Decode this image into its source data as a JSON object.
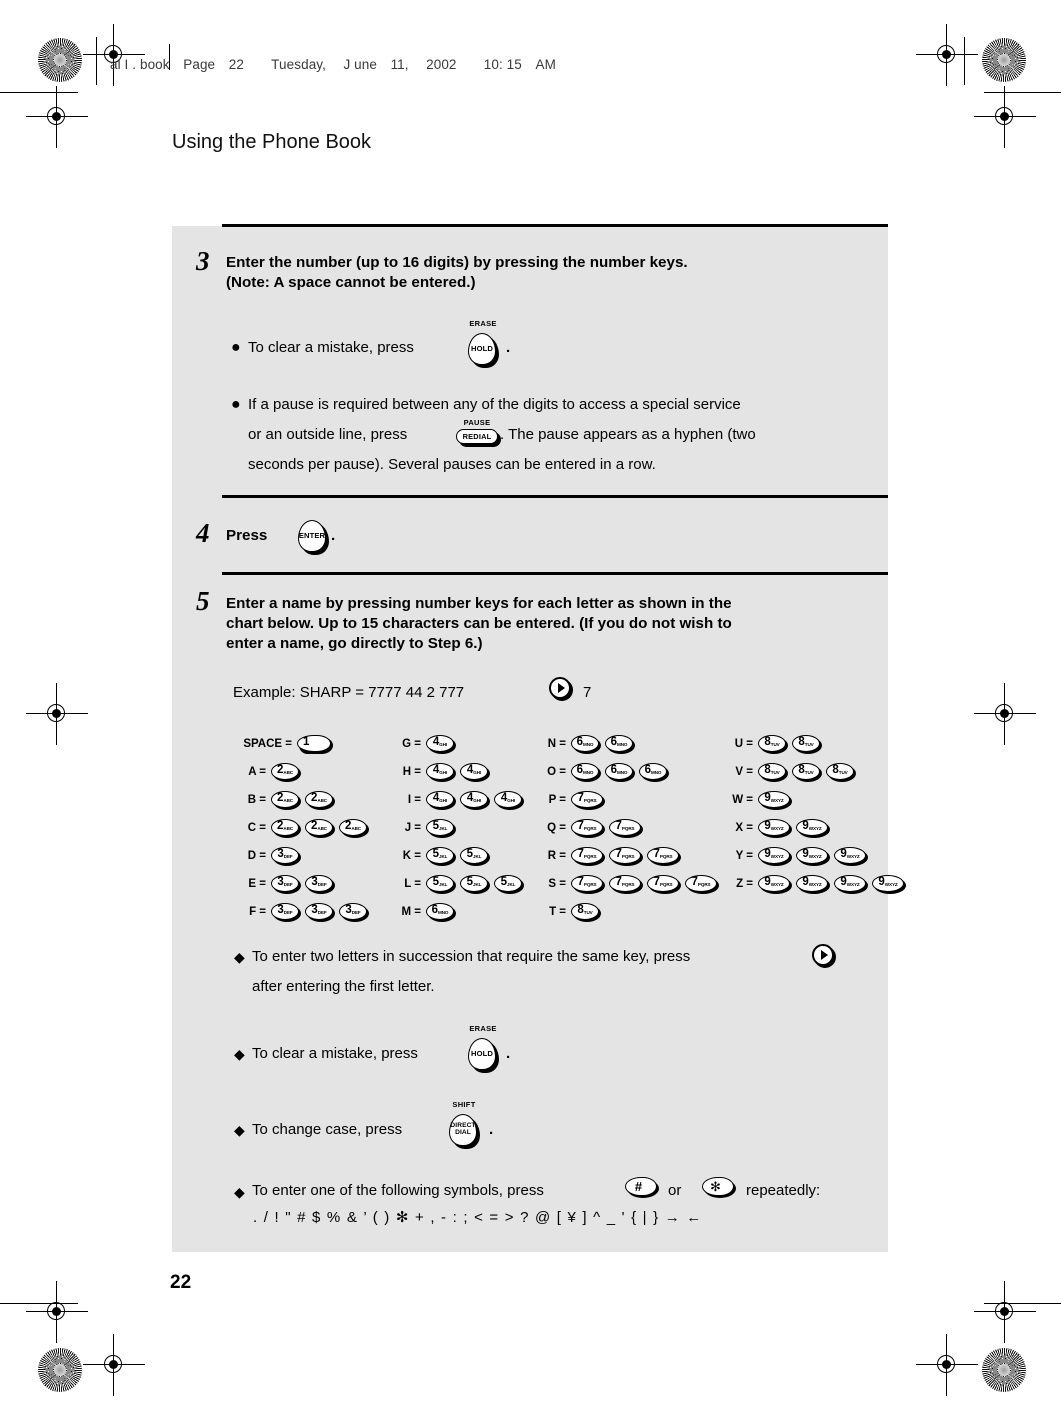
{
  "bleed_header": "al I . book　Page　22　　Tuesday, 　J une　11, 　2002　　10: 15　AM",
  "page_header": "Using the Phone Book",
  "page_number": "22",
  "steps": [
    {
      "number": "3",
      "title_line1": "Enter the number (up to 16 digits) by pressing the number keys.",
      "title_line2": "(Note: A space cannot be entered.)",
      "bullets": [
        {
          "pre": "To clear a mistake, press",
          "key": "HOLD",
          "key_top": "ERASE",
          "post": "."
        },
        {
          "line1_pre": "If a pause is required between any of the digits to access a special service",
          "line2_pre": "or an outside line, press",
          "key": "REDIAL",
          "key_top": "PAUSE",
          "line2_post": ". The pause appears as a hyphen (two",
          "line3": "seconds per pause). Several pauses can be entered in a row."
        }
      ]
    },
    {
      "number": "4",
      "title_pre": "Press",
      "key": "ENTER",
      "title_post": "."
    },
    {
      "number": "5",
      "title_line1": "Enter a name by pressing number keys for each letter as shown in the",
      "title_line2": "chart below. Up to 15 characters can be entered. (If you do not wish to",
      "title_line3": "enter a name, go directly to Step 6.)",
      "example_pre": "Example: SHARP = 7777  44  2  777",
      "example_post": "7",
      "notes": [
        {
          "line1": "To enter two letters in succession that require the same key, press",
          "line2": "after entering the first letter.",
          "icon": "right-arrow-key"
        },
        {
          "pre": "To clear a mistake, press",
          "key": "HOLD",
          "key_top": "ERASE",
          "post": "."
        },
        {
          "pre": "To change case, press",
          "key": "DIRECT DIAL",
          "key_top": "SHIFT",
          "post": "."
        },
        {
          "pre": "To enter one of the following symbols, press",
          "key1": "#",
          "mid": "or",
          "key2": "✻",
          "post": "repeatedly:",
          "symbols": ". / ! \" # $ % & ’ ( ) ✻ + , - : ; < = > ?  @  [ ¥ ] ^ _ ' { | } → ←"
        }
      ]
    }
  ],
  "letter_chart": {
    "columns": [
      {
        "rows": [
          {
            "label": "SPACE =",
            "keys": [
              {
                "digit": "1",
                "sub": "",
                "shape": "space"
              }
            ]
          },
          {
            "label": "A =",
            "keys": [
              {
                "digit": "2",
                "sub": "ABC"
              }
            ]
          },
          {
            "label": "B =",
            "keys": [
              {
                "digit": "2",
                "sub": "ABC"
              },
              {
                "digit": "2",
                "sub": "ABC"
              }
            ]
          },
          {
            "label": "C =",
            "keys": [
              {
                "digit": "2",
                "sub": "ABC"
              },
              {
                "digit": "2",
                "sub": "ABC"
              },
              {
                "digit": "2",
                "sub": "ABC"
              }
            ]
          },
          {
            "label": "D =",
            "keys": [
              {
                "digit": "3",
                "sub": "DEF"
              }
            ]
          },
          {
            "label": "E =",
            "keys": [
              {
                "digit": "3",
                "sub": "DEF"
              },
              {
                "digit": "3",
                "sub": "DEF"
              }
            ]
          },
          {
            "label": "F =",
            "keys": [
              {
                "digit": "3",
                "sub": "DEF"
              },
              {
                "digit": "3",
                "sub": "DEF"
              },
              {
                "digit": "3",
                "sub": "DEF"
              }
            ]
          }
        ]
      },
      {
        "rows": [
          {
            "label": "G =",
            "keys": [
              {
                "digit": "4",
                "sub": "GHI"
              }
            ]
          },
          {
            "label": "H =",
            "keys": [
              {
                "digit": "4",
                "sub": "GHI"
              },
              {
                "digit": "4",
                "sub": "GHI"
              }
            ]
          },
          {
            "label": "I  =",
            "keys": [
              {
                "digit": "4",
                "sub": "GHI"
              },
              {
                "digit": "4",
                "sub": "GHI"
              },
              {
                "digit": "4",
                "sub": "GHI"
              }
            ]
          },
          {
            "label": "J =",
            "keys": [
              {
                "digit": "5",
                "sub": "JKL"
              }
            ]
          },
          {
            "label": "K =",
            "keys": [
              {
                "digit": "5",
                "sub": "JKL"
              },
              {
                "digit": "5",
                "sub": "JKL"
              }
            ]
          },
          {
            "label": "L =",
            "keys": [
              {
                "digit": "5",
                "sub": "JKL"
              },
              {
                "digit": "5",
                "sub": "JKL"
              },
              {
                "digit": "5",
                "sub": "JKL"
              }
            ]
          },
          {
            "label": "M =",
            "keys": [
              {
                "digit": "6",
                "sub": "MNO"
              }
            ]
          }
        ]
      },
      {
        "rows": [
          {
            "label": "N =",
            "keys": [
              {
                "digit": "6",
                "sub": "MNO"
              },
              {
                "digit": "6",
                "sub": "MNO"
              }
            ]
          },
          {
            "label": "O =",
            "keys": [
              {
                "digit": "6",
                "sub": "MNO"
              },
              {
                "digit": "6",
                "sub": "MNO"
              },
              {
                "digit": "6",
                "sub": "MNO"
              }
            ]
          },
          {
            "label": "P =",
            "keys": [
              {
                "digit": "7",
                "sub": "PQRS"
              }
            ]
          },
          {
            "label": "Q =",
            "keys": [
              {
                "digit": "7",
                "sub": "PQRS"
              },
              {
                "digit": "7",
                "sub": "PQRS"
              }
            ]
          },
          {
            "label": "R =",
            "keys": [
              {
                "digit": "7",
                "sub": "PQRS"
              },
              {
                "digit": "7",
                "sub": "PQRS"
              },
              {
                "digit": "7",
                "sub": "PQRS"
              }
            ]
          },
          {
            "label": "S =",
            "keys": [
              {
                "digit": "7",
                "sub": "PQRS"
              },
              {
                "digit": "7",
                "sub": "PQRS"
              },
              {
                "digit": "7",
                "sub": "PQRS"
              },
              {
                "digit": "7",
                "sub": "PQRS"
              }
            ]
          },
          {
            "label": "T =",
            "keys": [
              {
                "digit": "8",
                "sub": "TUV"
              }
            ]
          }
        ]
      },
      {
        "rows": [
          {
            "label": "U =",
            "keys": [
              {
                "digit": "8",
                "sub": "TUV"
              },
              {
                "digit": "8",
                "sub": "TUV"
              }
            ]
          },
          {
            "label": "V =",
            "keys": [
              {
                "digit": "8",
                "sub": "TUV"
              },
              {
                "digit": "8",
                "sub": "TUV"
              },
              {
                "digit": "8",
                "sub": "TUV"
              }
            ]
          },
          {
            "label": "W =",
            "keys": [
              {
                "digit": "9",
                "sub": "WXYZ"
              }
            ]
          },
          {
            "label": "X =",
            "keys": [
              {
                "digit": "9",
                "sub": "WXYZ"
              },
              {
                "digit": "9",
                "sub": "WXYZ"
              }
            ]
          },
          {
            "label": "Y =",
            "keys": [
              {
                "digit": "9",
                "sub": "WXYZ"
              },
              {
                "digit": "9",
                "sub": "WXYZ"
              },
              {
                "digit": "9",
                "sub": "WXYZ"
              }
            ]
          },
          {
            "label": "Z =",
            "keys": [
              {
                "digit": "9",
                "sub": "WXYZ"
              },
              {
                "digit": "9",
                "sub": "WXYZ"
              },
              {
                "digit": "9",
                "sub": "WXYZ"
              },
              {
                "digit": "9",
                "sub": "WXYZ"
              }
            ]
          }
        ]
      }
    ]
  }
}
